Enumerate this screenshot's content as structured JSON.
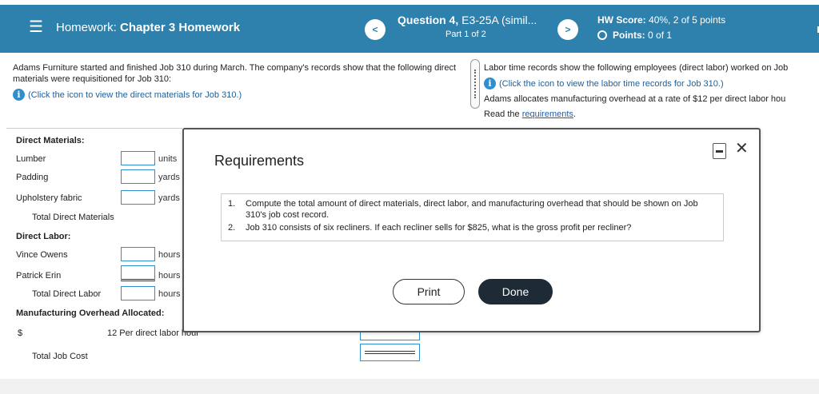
{
  "header": {
    "menu_icon": "hamburger-menu-icon",
    "hw_prefix": "Homework:",
    "hw_title": "Chapter 3 Homework",
    "question_label": "Question 4,",
    "question_name": "E3-25A (simil...",
    "part": "Part 1 of 2",
    "score_label": "HW Score:",
    "score_value": "40%, 2 of 5 points",
    "points_label": "Points:",
    "points_value": "0 of 1",
    "prev_icon": "<",
    "next_icon": ">"
  },
  "problem_left": {
    "text": "Adams  Furniture started and finished Job 310 during March. The company's records show that the following direct materials were requisitioned for Job 310:",
    "info_text": "(Click the icon to view the direct materials for Job 310.)"
  },
  "problem_right": {
    "line1": "Labor time records show the following employees (direct labor) worked on Job",
    "info_text": "(Click the icon to view the labor time records for Job 310.)",
    "line3": "Adams  allocates manufacturing overhead at a rate of $12 per direct labor hou",
    "read_prefix": "Read the",
    "requirements_link": "requirements",
    "read_suffix": "."
  },
  "work": {
    "direct_materials": "Direct Materials:",
    "lumber": "Lumber",
    "padding": "Padding",
    "upholstery": "Upholstery fabric",
    "total_dm": "Total Direct Materials",
    "direct_labor": "Direct Labor:",
    "vince": "Vince Owens",
    "patrick": "Patrick Erin",
    "total_dl": "Total Direct Labor",
    "moh": "Manufacturing Overhead Allocated:",
    "dollar": "$",
    "rate_text": "12 Per direct labor hour",
    "total_job": "Total Job Cost",
    "unit_units": "units",
    "unit_yards1": "yards",
    "unit_yards2": "yards",
    "unit_hours1": "hours",
    "unit_hours2": "hours",
    "unit_hours3": "hours"
  },
  "dialog": {
    "title": "Requirements",
    "items": [
      {
        "num": "1.",
        "text": "Compute the total amount of direct materials, direct labor, and manufacturing overhead that should be shown on Job 310's job cost record."
      },
      {
        "num": "2.",
        "text": "Job 310 consists of six recliners. If each recliner sells for $825, what is the gross profit per recliner?"
      }
    ],
    "close_icon": "✕",
    "print_label": "Print",
    "done_label": "Done"
  }
}
